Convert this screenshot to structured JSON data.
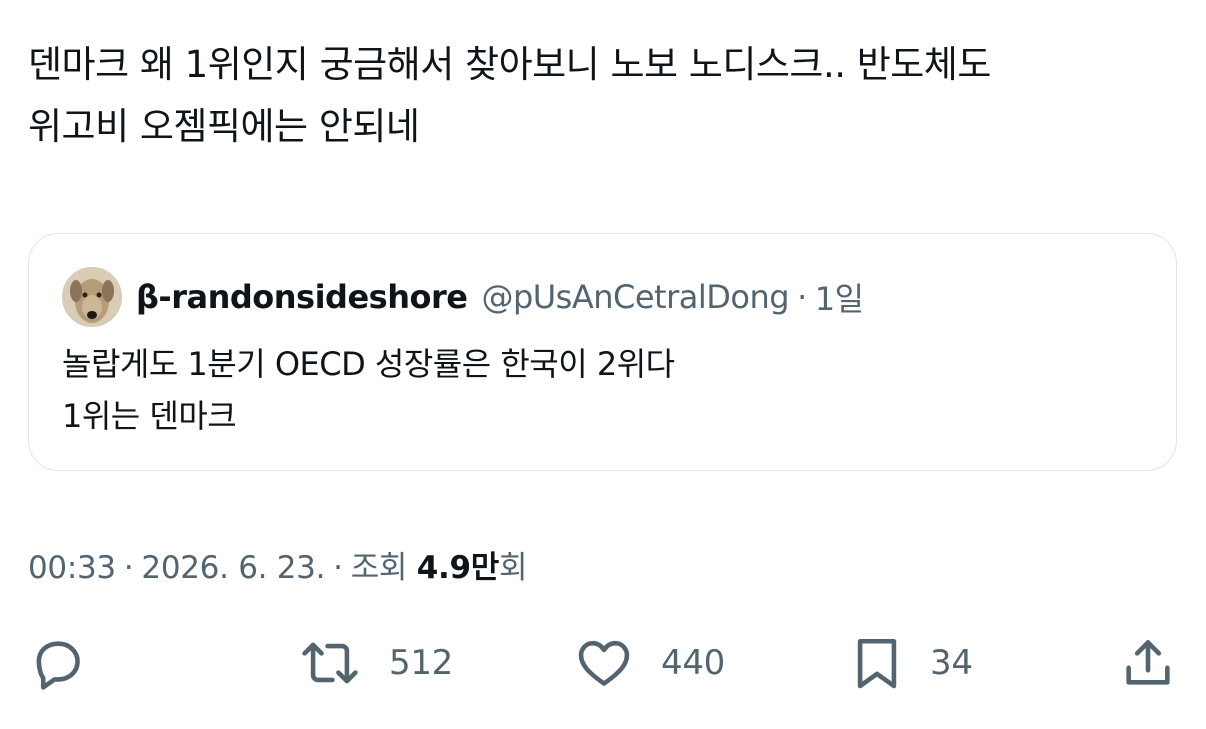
{
  "tweet": {
    "line1": "덴마크 왜 1위인지 궁금해서 찾아보니 노보 노디스크.. 반도체도",
    "line2": "위고비 오젬픽에는 안되네"
  },
  "quote": {
    "name": "β-randonsideshore",
    "handle": "@pUsAnCetralDong",
    "dot": "·",
    "time": "1일",
    "body_line1": "놀랍게도 1분기 OECD 성장률은 한국이 2위다",
    "body_line2": "1위는 덴마크",
    "avatar_icon": "dog-avatar-icon"
  },
  "meta": {
    "time": "00:33",
    "dot1": "·",
    "date": "2026. 6. 23.",
    "dot2": "·",
    "views_label": "조회",
    "views_count": "4.9만",
    "views_suffix": "회"
  },
  "actions": {
    "reply_icon": "reply-icon",
    "retweet_icon": "retweet-icon",
    "retweet_count": "512",
    "like_icon": "heart-icon",
    "like_count": "440",
    "bookmark_icon": "bookmark-icon",
    "bookmark_count": "34",
    "share_icon": "share-icon"
  },
  "colors": {
    "text_primary": "#0f1419",
    "text_secondary": "#536471",
    "border": "#e1e5e8"
  }
}
